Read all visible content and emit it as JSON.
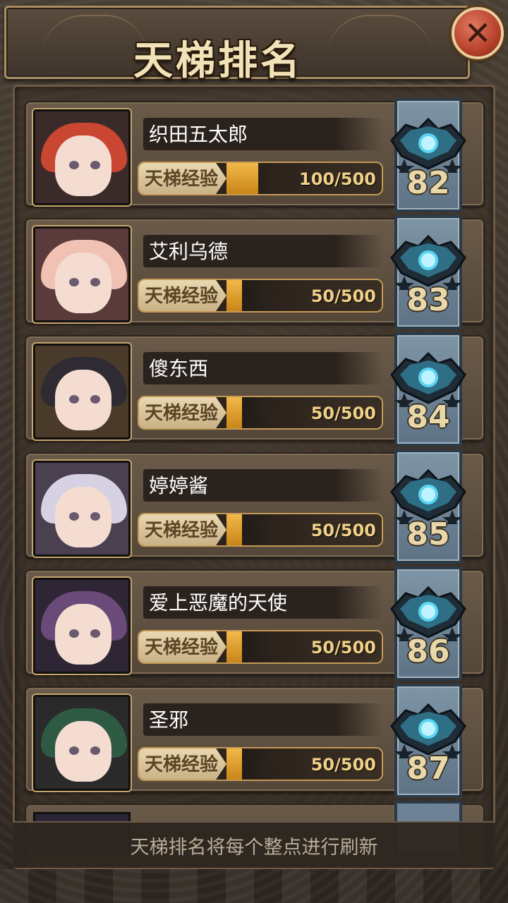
{
  "header": {
    "title": "天梯排名"
  },
  "close_icon": "close-icon",
  "exp_label": "天梯经验",
  "players": [
    {
      "name": "织田五太郎",
      "exp_current": 100,
      "exp_max": 500,
      "exp_text": "100/500",
      "rank": "82",
      "hair_color": "#c84632",
      "bg_color": "#3a2a2a"
    },
    {
      "name": "艾利乌德",
      "exp_current": 50,
      "exp_max": 500,
      "exp_text": "50/500",
      "rank": "83",
      "hair_color": "#f1c2b4",
      "bg_color": "#5a3a3a"
    },
    {
      "name": "傻东西",
      "exp_current": 50,
      "exp_max": 500,
      "exp_text": "50/500",
      "rank": "84",
      "hair_color": "#2e2b33",
      "bg_color": "#4a3a2a"
    },
    {
      "name": "婷婷酱",
      "exp_current": 50,
      "exp_max": 500,
      "exp_text": "50/500",
      "rank": "85",
      "hair_color": "#d6d2e4",
      "bg_color": "#4a4050"
    },
    {
      "name": "爱上恶魔的天使",
      "exp_current": 50,
      "exp_max": 500,
      "exp_text": "50/500",
      "rank": "86",
      "hair_color": "#6a4a78",
      "bg_color": "#2e2634"
    },
    {
      "name": "圣邪",
      "exp_current": 50,
      "exp_max": 500,
      "exp_text": "50/500",
      "rank": "87",
      "hair_color": "#2e5a44",
      "bg_color": "#2a2a2a"
    }
  ],
  "footer": {
    "notice": "天梯排名将每个整点进行刷新"
  }
}
